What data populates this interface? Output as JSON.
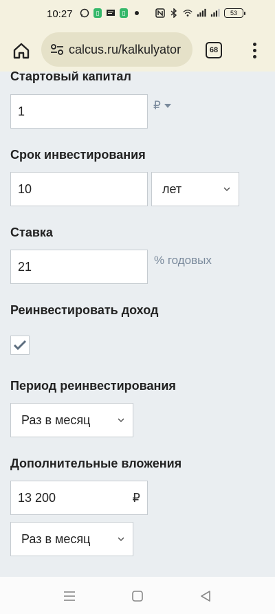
{
  "status_bar": {
    "time": "10:27",
    "battery": "53"
  },
  "browser": {
    "url": "calcus.ru/kalkulyator",
    "tab_count": "68"
  },
  "form": {
    "start_capital": {
      "label": "Стартовый капитал",
      "value": "1",
      "currency": "₽"
    },
    "term": {
      "label": "Срок инвестирования",
      "value": "10",
      "unit": "лет"
    },
    "rate": {
      "label": "Ставка",
      "value": "21",
      "suffix": "% годовых"
    },
    "reinvest": {
      "label": "Реинвестировать доход",
      "checked": true
    },
    "reinvest_period": {
      "label": "Период реинвестирования",
      "value": "Раз в месяц"
    },
    "additional": {
      "label": "Дополнительные вложения",
      "value": "13 200",
      "currency": "₽",
      "period": "Раз в месяц"
    }
  }
}
